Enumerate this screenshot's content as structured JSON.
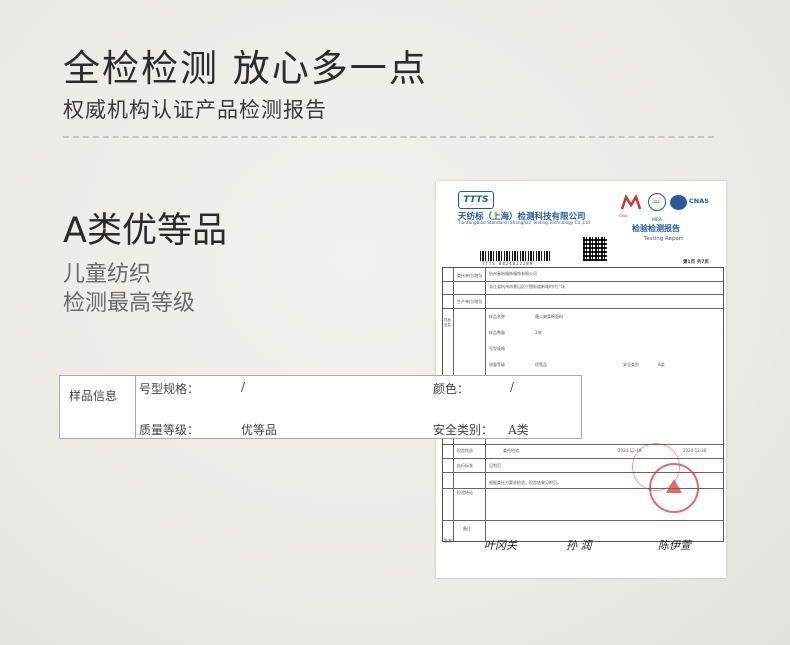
{
  "headline": "全检检测 放心多一点",
  "subhead": "权威机构认证产品检测报告",
  "grade": "A类优等品",
  "desc_line1": "儿童纺织",
  "desc_line2": "检测最高等级",
  "report": {
    "logo": "TTTS",
    "company_cn": "天纺标（上海）检测科技有限公司",
    "company_en": "Tianfangbiao Standard (Shanghai) Testing Technology Co.,Ltd",
    "title_cn": "检验检测报告",
    "title_en": "Testing Report",
    "page_no": "第1页 共7页",
    "barcode_text": "TTTS B824022289",
    "ma_text": "CMA",
    "ilac_text": "ilac-MRA",
    "cnas_text": "CNAS",
    "client_label": "委托单位/地址",
    "client_value": "杭州春始服饰服饰有限公司",
    "client_addr": "浙江省杭州市萧山区宁围街道新城时代广场",
    "producer_label": "生产单位/地址",
    "sample_label": "样品信息",
    "sample_name_label": "样品名称",
    "sample_name": "羅公爽柔棉面料",
    "sample_qty_label": "样品数量",
    "sample_qty": "2块",
    "model_label": "号型规格",
    "grade_label": "质量等级",
    "grade_value": "优等品",
    "safety_label": "安全类别",
    "safety_value": "A类",
    "test_label": "检验性质",
    "test_value": "委托检验",
    "date_value": "2024-12-19",
    "date_end": "2024-12-30",
    "exec_label": "执行标准",
    "exec_value": "见附页",
    "conclusion_label": "检验结论",
    "conclusion_value": "根据委托方要求检验，检验结果见附页。",
    "remark_label": "备注",
    "sig_editor_label": "批准：",
    "sig1": "叶冈关",
    "sig2": "孙 润",
    "sig3": "陈伊萱"
  },
  "info_table": {
    "row_label": "样品信息",
    "model_label": "号型规格：",
    "model_value": "/",
    "color_label": "颜色：",
    "color_value": "/",
    "grade_label": "质量等级：",
    "grade_value": "优等品",
    "safety_label": "安全类别：",
    "safety_value": "A类"
  }
}
